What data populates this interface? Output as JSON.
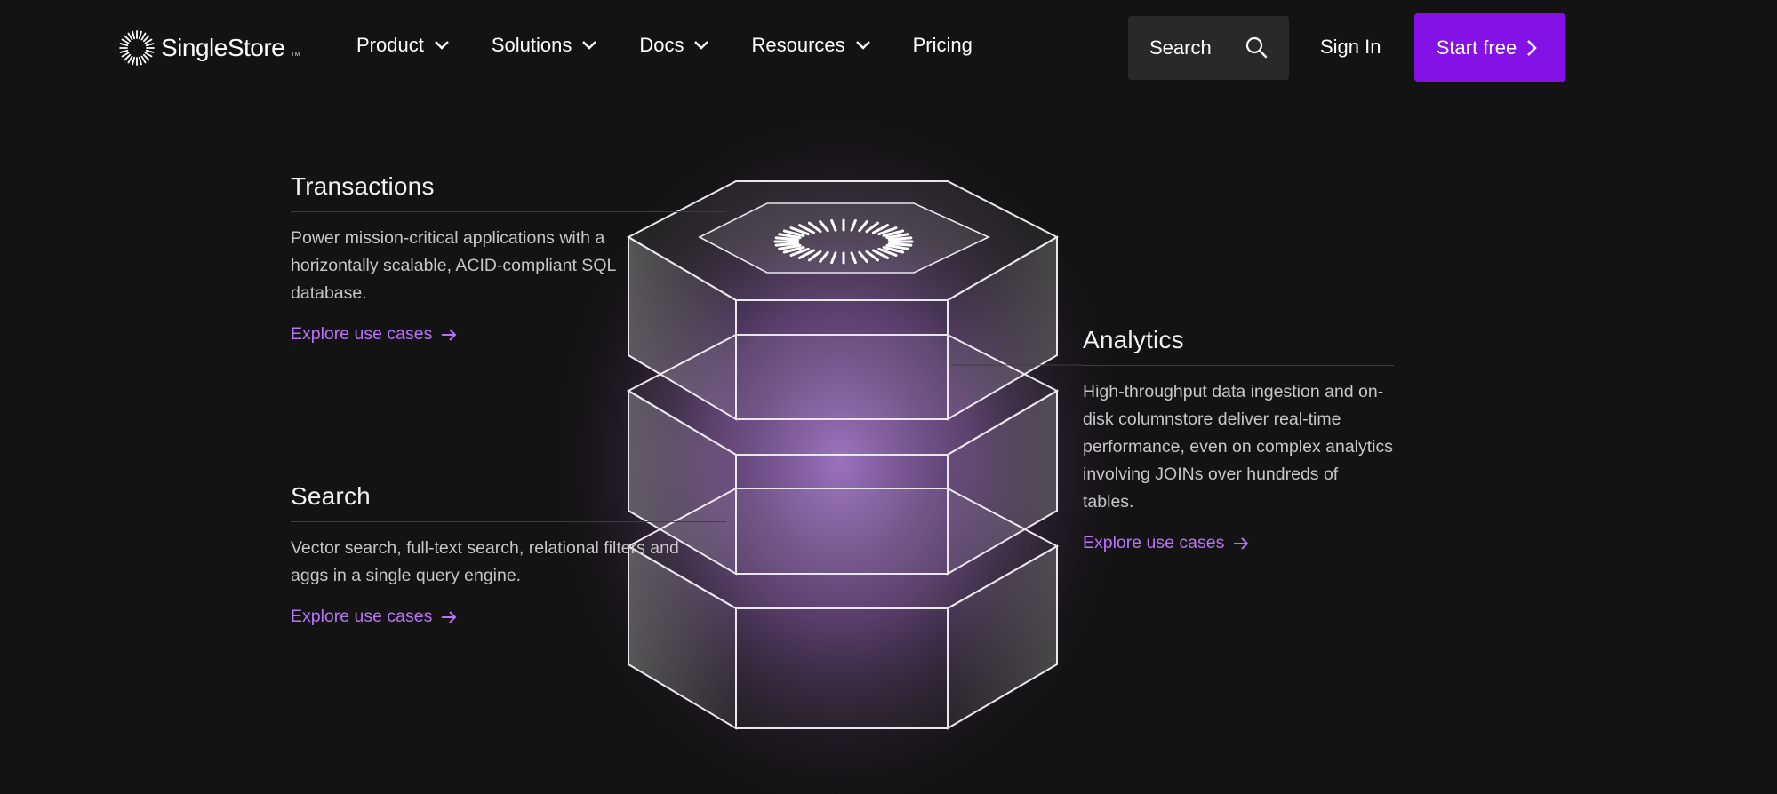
{
  "nav": {
    "logo_text": "SingleStore",
    "logo_tm": "TM",
    "menu": [
      {
        "label": "Product",
        "dropdown": true
      },
      {
        "label": "Solutions",
        "dropdown": true
      },
      {
        "label": "Docs",
        "dropdown": true
      },
      {
        "label": "Resources",
        "dropdown": true
      },
      {
        "label": "Pricing",
        "dropdown": false
      }
    ],
    "search_label": "Search",
    "signin_label": "Sign In",
    "cta_label": "Start free"
  },
  "features": {
    "transactions": {
      "title": "Transactions",
      "description": "Power mission-critical applications with a horizontally scalable, ACID-compliant SQL database.",
      "link": "Explore use cases"
    },
    "search": {
      "title": "Search",
      "description": "Vector search, full-text search, relational filters and aggs in a single query engine.",
      "link": "Explore use cases"
    },
    "analytics": {
      "title": "Analytics",
      "description": "High-throughput data ingestion and on-disk columnstore deliver real-time performance, even on complex analytics involving JOINs over hundreds of tables.",
      "link": "Explore use cases"
    }
  },
  "colors": {
    "background": "#141314",
    "accent": "#8411e6",
    "link": "#b873f7",
    "glow": "#9b6fc0"
  }
}
